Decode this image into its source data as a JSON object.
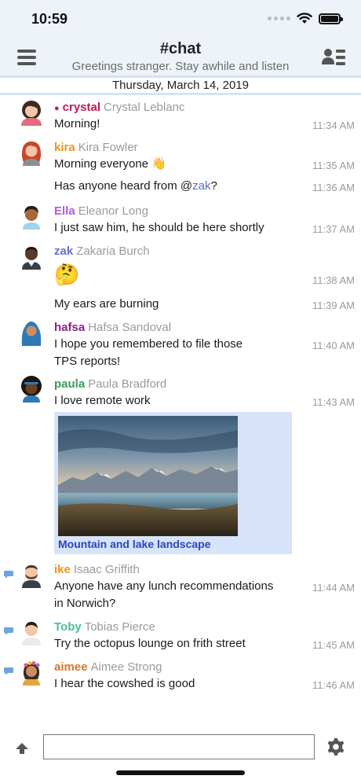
{
  "status_bar": {
    "time": "10:59"
  },
  "header": {
    "title": "#chat",
    "topic": "Greetings stranger. Stay awhile and listen"
  },
  "date_separator": "Thursday, March 14, 2019",
  "messages": [
    {
      "nick": "crystal",
      "realname": "Crystal Leblanc",
      "text": "Morning!",
      "time": "11:34 AM",
      "nick_color": "#c2185b",
      "avatar": "woman-dark-hair-avatar"
    },
    {
      "nick": "kira",
      "realname": "Kira Fowler",
      "text": "Morning everyone 👋",
      "time": "11:35 AM",
      "nick_color": "#f0941b",
      "avatar": "woman-red-hair-avatar"
    },
    {
      "text_before": "Has anyone heard from @",
      "mention": "zak",
      "text_after": "?",
      "time": "11:36 AM"
    },
    {
      "nick": "Ella",
      "realname": "Eleanor Long",
      "text": "I just saw him, he should be here shortly",
      "time": "11:37 AM",
      "nick_color": "#b35ad6",
      "avatar": "person-curly-hair-avatar"
    },
    {
      "nick": "zak",
      "realname": "Zakaria Burch",
      "text": "🤔",
      "time": "11:38 AM",
      "nick_color": "#6b6bd6",
      "avatar": "man-dark-skin-avatar"
    },
    {
      "text": "My ears are burning",
      "time": "11:39 AM"
    },
    {
      "nick": "hafsa",
      "realname": "Hafsa Sandoval",
      "text_line1": "I hope you remembered to file those",
      "text_line2": "TPS reports!",
      "time": "11:40 AM",
      "nick_color": "#8e1f8e",
      "avatar": "woman-hijab-avatar"
    },
    {
      "nick": "paula",
      "realname": "Paula Bradford",
      "text": "I love remote work",
      "time": "11:43 AM",
      "nick_color": "#3a9a5a",
      "avatar": "woman-afro-avatar"
    },
    {
      "nick": "ike",
      "realname": "Isaac Griffith",
      "text_line1": "Anyone have any lunch recommendations",
      "text_line2": "in Norwich?",
      "time": "11:44 AM",
      "nick_color": "#f0941b",
      "avatar": "man-beard-avatar"
    },
    {
      "nick": "Toby",
      "realname": "Tobias Pierce",
      "text": "Try the octopus lounge on frith street",
      "time": "11:45 AM",
      "nick_color": "#4bbf9a",
      "avatar": "man-short-hair-avatar"
    },
    {
      "nick": "aimee",
      "realname": "Aimee Strong",
      "text": "I hear the cowshed is good",
      "time": "11:46 AM",
      "nick_color": "#d9762b",
      "avatar": "woman-flower-crown-avatar"
    }
  ],
  "image_attachment": {
    "caption": "Mountain and lake landscape"
  },
  "composer": {
    "value": "",
    "placeholder": ""
  },
  "colors": {
    "header_bg": "#eef3fa",
    "date_border": "#d6e3f5",
    "mention": "#5a6ec4",
    "link": "#2845c4",
    "image_card_bg": "#d7e3f9"
  }
}
